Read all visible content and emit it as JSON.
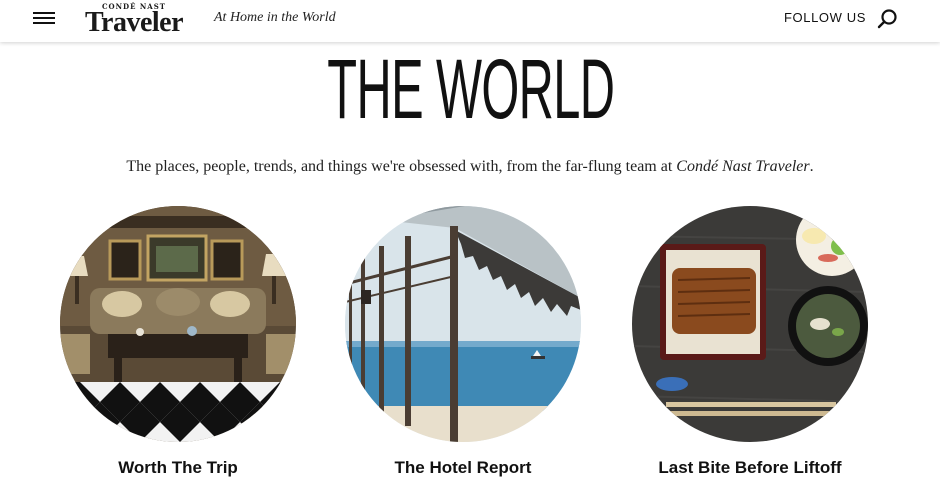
{
  "header": {
    "brand_top": "CONDÉ NAST",
    "brand_main": "Traveler",
    "tagline": "At Home in the World",
    "follow_label": "FOLLOW US"
  },
  "hero": {
    "title": "THE WORLD",
    "intro_main": "The places, people, trends, and things we're obsessed with, from the far-flung team at ",
    "intro_brand": "Condé Nast Traveler",
    "intro_end": "."
  },
  "cards": [
    {
      "label": "Worth The Trip",
      "image": "luxury-lounge-interior-photo"
    },
    {
      "label": "The Hotel Report",
      "image": "seaside-veranda-photo"
    },
    {
      "label": "Last Bite Before Liftoff",
      "image": "unagi-bento-meal-photo"
    }
  ],
  "icons": {
    "menu": "hamburger-menu-icon",
    "search": "search-icon"
  }
}
